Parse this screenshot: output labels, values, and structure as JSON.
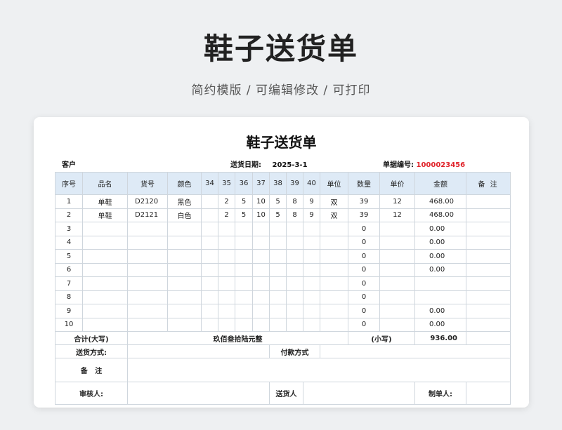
{
  "hero": {
    "title": "鞋子送货单",
    "subtitle": "简约模版 / 可编辑修改 / 可打印"
  },
  "doc": {
    "title": "鞋子送货单",
    "customer_label": "客户",
    "date_label": "送货日期:",
    "date_value": "2025-3-1",
    "number_label": "单据编号:",
    "number_value": "1000023456"
  },
  "columns": [
    "序号",
    "品名",
    "货号",
    "颜色",
    "34",
    "35",
    "36",
    "37",
    "38",
    "39",
    "40",
    "单位",
    "数量",
    "单价",
    "金额",
    "备 注"
  ],
  "rows": [
    [
      "1",
      "单鞋",
      "D2120",
      "黑色",
      "",
      "2",
      "5",
      "10",
      "5",
      "8",
      "9",
      "双",
      "39",
      "12",
      "468.00",
      ""
    ],
    [
      "2",
      "单鞋",
      "D2121",
      "白色",
      "",
      "2",
      "5",
      "10",
      "5",
      "8",
      "9",
      "双",
      "39",
      "12",
      "468.00",
      ""
    ],
    [
      "3",
      "",
      "",
      "",
      "",
      "",
      "",
      "",
      "",
      "",
      "",
      "",
      "0",
      "",
      "0.00",
      ""
    ],
    [
      "4",
      "",
      "",
      "",
      "",
      "",
      "",
      "",
      "",
      "",
      "",
      "",
      "0",
      "",
      "0.00",
      ""
    ],
    [
      "5",
      "",
      "",
      "",
      "",
      "",
      "",
      "",
      "",
      "",
      "",
      "",
      "0",
      "",
      "0.00",
      ""
    ],
    [
      "6",
      "",
      "",
      "",
      "",
      "",
      "",
      "",
      "",
      "",
      "",
      "",
      "0",
      "",
      "0.00",
      ""
    ],
    [
      "7",
      "",
      "",
      "",
      "",
      "",
      "",
      "",
      "",
      "",
      "",
      "",
      "0",
      "",
      "",
      ""
    ],
    [
      "8",
      "",
      "",
      "",
      "",
      "",
      "",
      "",
      "",
      "",
      "",
      "",
      "0",
      "",
      "",
      ""
    ],
    [
      "9",
      "",
      "",
      "",
      "",
      "",
      "",
      "",
      "",
      "",
      "",
      "",
      "0",
      "",
      "0.00",
      ""
    ],
    [
      "10",
      "",
      "",
      "",
      "",
      "",
      "",
      "",
      "",
      "",
      "",
      "",
      "0",
      "",
      "0.00",
      ""
    ]
  ],
  "totals": {
    "label": "合计(大写)",
    "upper": "玖佰叁拾陆元整",
    "small_label": "(小写)",
    "small_value": "936.00"
  },
  "footer": {
    "delivery_method": "送货方式:",
    "payment_method": "付款方式",
    "remark": "备   注",
    "reviewer": "审核人:",
    "deliverer": "送货人",
    "maker": "制单人:"
  }
}
